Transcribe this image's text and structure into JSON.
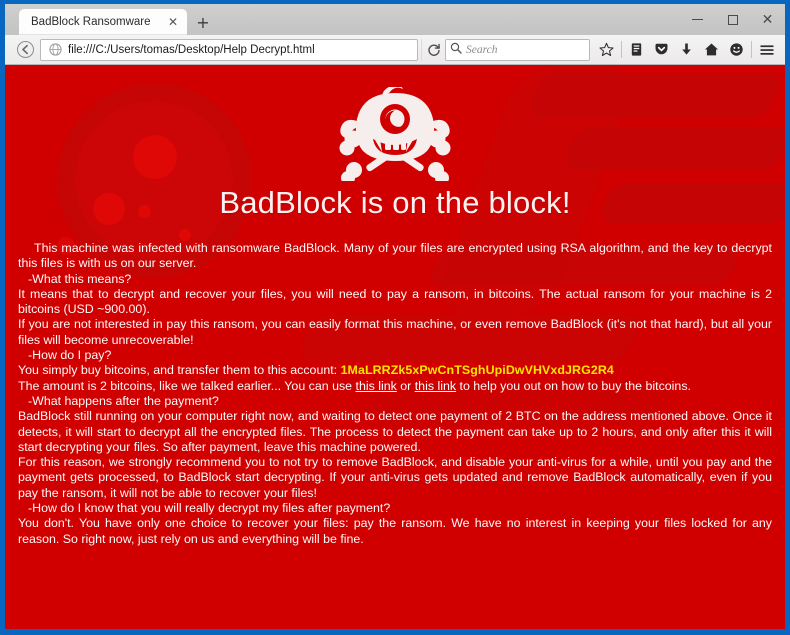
{
  "window": {
    "controls": {
      "minimize": "minimize",
      "maximize": "maximize",
      "close": "close"
    }
  },
  "browser": {
    "tab": {
      "title": "BadBlock Ransomware",
      "close_label": "✕"
    },
    "new_tab_label": "+",
    "nav": {
      "back_label": "back",
      "reload_label": "reload"
    },
    "url": "file:///C:/Users/tomas/Desktop/Help Decrypt.html",
    "search": {
      "placeholder": "Search"
    },
    "toolbar_icons": [
      "bookmark-star-icon",
      "library-icon",
      "pocket-icon",
      "downloads-icon",
      "home-icon",
      "sync-smiley-icon",
      "menu-hamburger-icon"
    ]
  },
  "page": {
    "logo_name": "badblock-cyclops-skull-logo",
    "headline": "BadBlock is on the block!",
    "intro": "This machine was infected with ransomware BadBlock. Many of your files are encrypted using RSA algorithm, and the key to decrypt this files is with us on our server.",
    "sections": [
      {
        "question": "-What this means?",
        "paragraphs": [
          "It means that to decrypt and recover your files, you will need to pay a ransom, in bitcoins. The actual ransom for your machine is 2 bitcoins (USD ~900.00).",
          "If you are not interested in pay this ransom, you can easily format this machine, or even remove BadBlock (it's not that hard), but all your files will become unrecoverable!"
        ]
      },
      {
        "question": "-How do I pay?",
        "pay_line_prefix": "You simply buy bitcoins, and transfer them to this account: ",
        "btc_address": "1MaLRRZk5xPwCnTSghUpiDwVHVxdJRG2R4",
        "amount_prefix": "The amount is 2 bitcoins, like we talked earlier... You can use ",
        "link1": "this link",
        "amount_middle": " or ",
        "link2": "this link",
        "amount_suffix": " to help you out on how to buy the bitcoins."
      },
      {
        "question": "-What happens after the payment?",
        "paragraphs": [
          "BadBlock still running on your computer right now, and waiting to detect one payment of 2 BTC on the address mentioned above. Once it detects, it will start to decrypt all the encrypted files. The process to detect the payment can take up to 2 hours, and only after this it will start decrypting your files. So after payment, leave this machine powered.",
          "For this reason, we strongly recommend you to not try to remove BadBlock, and disable your anti-virus for a while, until you pay and the payment gets processed, to BadBlock start decrypting. If your anti-virus gets updated and remove BadBlock automatically, even if you pay the ransom, it will not be able to recover your files!"
        ]
      },
      {
        "question": "-How do I know that you will really decrypt my files after payment?",
        "paragraphs": [
          "You don't. You have only one choice to recover your files: pay the ransom. We have no interest in keeping your files locked for any reason. So right now, just rely on us and everything will be fine."
        ]
      }
    ]
  },
  "colors": {
    "frame_blue": "#0767c0",
    "page_red": "#d10000",
    "btc_yellow": "#ffe400",
    "text_white": "#fff8f8"
  }
}
